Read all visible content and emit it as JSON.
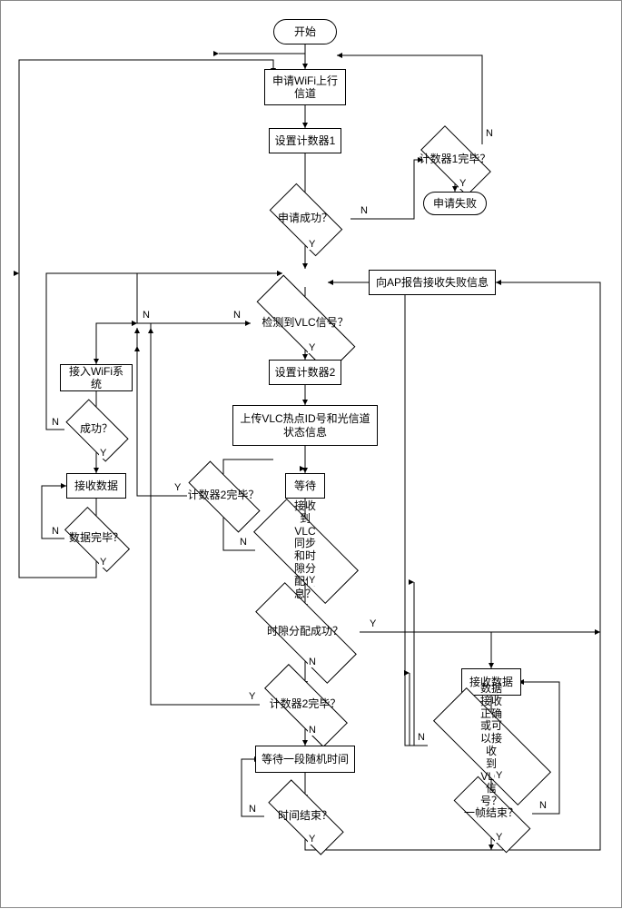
{
  "flow": {
    "start": "开始",
    "request_wifi": "申请WiFi上行\n信道",
    "set_counter1": "设置计数器1",
    "counter1_done": "计数器1完毕？",
    "request_fail": "申请失败",
    "request_success": "申请成功？",
    "report_fail": "向AP报告接收失败信息",
    "detect_vlc": "检测到VLC信号？",
    "access_wifi": "接入WiFi系统",
    "success_q": "成功？",
    "recv_data_left": "接收数据",
    "data_done_left": "数据完毕？",
    "set_counter2": "设置计数器2",
    "upload_info": "上传VLC热点ID号和光信道状态信息",
    "wait": "等待",
    "counter2_q1": "计数器2完毕？",
    "recv_sync": "接收到VLC同步和时隙分\n配信息？",
    "slot_success": "时隙分配成功？",
    "counter2_q2": "计数器2完毕？",
    "wait_random": "等待一段随机时间",
    "time_end": "时间结束？",
    "recv_data_right": "接收数据",
    "data_ok_vlc": "数据接收正确或可以接收\n到VLC信号？",
    "frame_end": "一帧结束？"
  },
  "labels": {
    "Y": "Y",
    "N": "N"
  }
}
